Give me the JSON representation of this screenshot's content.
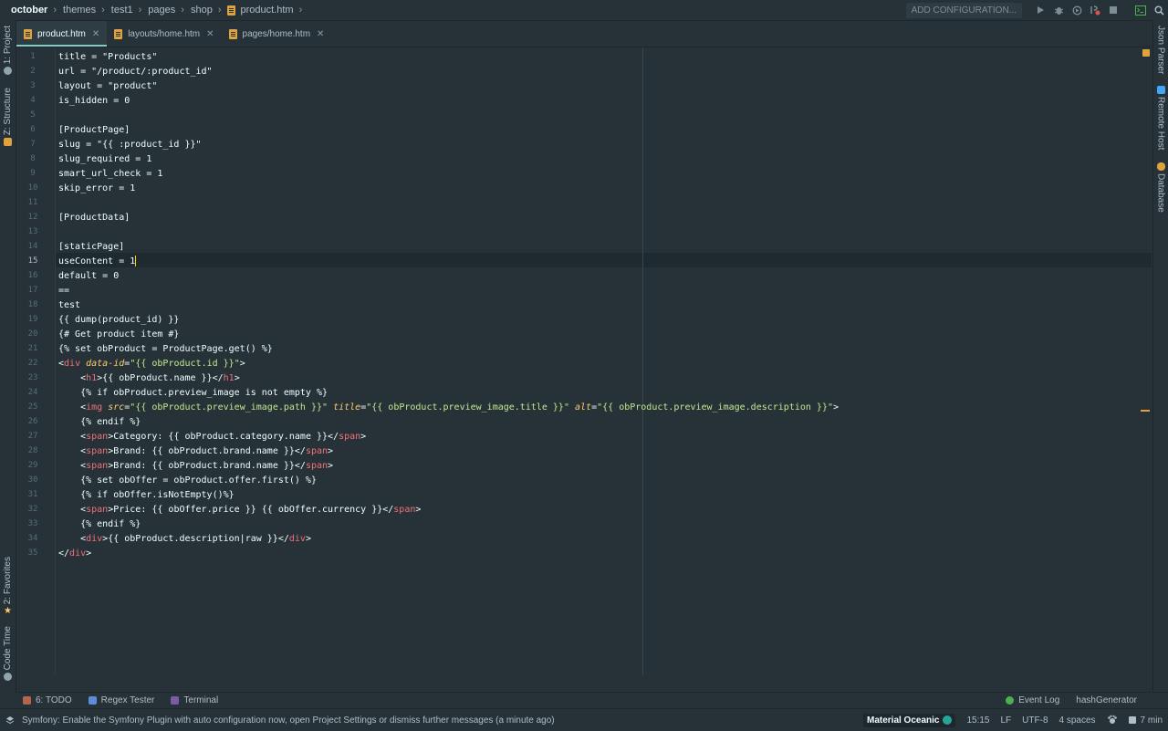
{
  "breadcrumbs": [
    "october",
    "themes",
    "test1",
    "pages",
    "shop",
    "product.htm"
  ],
  "run_toolbar": {
    "add_configuration": "ADD CONFIGURATION...",
    "icons": [
      "run-icon",
      "debug-icon",
      "coverage-icon",
      "profiler-icon",
      "stop-icon",
      "terminal-icon",
      "search-icon"
    ]
  },
  "left_tools": [
    {
      "label": "1: Project",
      "icon": "project-icon"
    },
    {
      "label": "Z: Structure",
      "icon": "structure-icon"
    },
    {
      "label": "2: Favorites",
      "icon": "star-icon"
    },
    {
      "label": "Code Time",
      "icon": "clock-icon"
    }
  ],
  "right_tools": [
    {
      "label": "Json Parser",
      "icon": "json-icon"
    },
    {
      "label": "Remote Host",
      "icon": "remote-host-icon"
    },
    {
      "label": "Database",
      "icon": "database-icon"
    }
  ],
  "tabs": [
    {
      "label": "product.htm",
      "active": true
    },
    {
      "label": "layouts/home.htm",
      "active": false
    },
    {
      "label": "pages/home.htm",
      "active": false
    }
  ],
  "editor": {
    "current_line": 15,
    "lines": [
      "title = \"Products\"",
      "url = \"/product/:product_id\"",
      "layout = \"product\"",
      "is_hidden = 0",
      "",
      "[ProductPage]",
      "slug = \"{{ :product_id }}\"",
      "slug_required = 1",
      "smart_url_check = 1",
      "skip_error = 1",
      "",
      "[ProductData]",
      "",
      "[staticPage]",
      "useContent = 1",
      "default = 0",
      "==",
      "test",
      "{{ dump(product_id) }}",
      "{# Get product item #}",
      "{% set obProduct = ProductPage.get() %}",
      "<div data-id=\"{{ obProduct.id }}\">",
      "    <h1>{{ obProduct.name }}</h1>",
      "    {% if obProduct.preview_image is not empty %}",
      "    <img src=\"{{ obProduct.preview_image.path }}\" title=\"{{ obProduct.preview_image.title }}\" alt=\"{{ obProduct.preview_image.description }}\">",
      "    {% endif %}",
      "    <span>Category: {{ obProduct.category.name }}</span>",
      "    <span>Brand: {{ obProduct.brand.name }}</span>",
      "    <span>Brand: {{ obProduct.brand.name }}</span>",
      "    {% set obOffer = obProduct.offer.first() %}",
      "    {% if obOffer.isNotEmpty()%}",
      "    <span>Price: {{ obOffer.price }} {{ obOffer.currency }}</span>",
      "    {% endif %}",
      "    <div>{{ obProduct.description|raw }}</div>",
      "</div>"
    ]
  },
  "bottom_tools": [
    {
      "label": "6: TODO",
      "icon": "todo-icon"
    },
    {
      "label": "Regex Tester",
      "icon": "regex-icon"
    },
    {
      "label": "Terminal",
      "icon": "terminal-icon"
    }
  ],
  "bottom_tools_right": [
    {
      "label": "Event Log",
      "icon": "event-log-icon"
    },
    {
      "label": "hashGenerator",
      "icon": ""
    }
  ],
  "status": {
    "message": "Symfony: Enable the Symfony Plugin with auto configuration now, open Project Settings or dismiss further messages (a minute ago)",
    "theme": "Material Oceanic",
    "position": "15:15",
    "line_ending": "LF",
    "encoding": "UTF-8",
    "indent": "4 spaces",
    "time": "7 min"
  },
  "colors": {
    "background": "#263238",
    "accent": "#80cbc4",
    "tag": "#f07178",
    "attribute": "#ffcb6b",
    "string": "#c3e88d"
  }
}
